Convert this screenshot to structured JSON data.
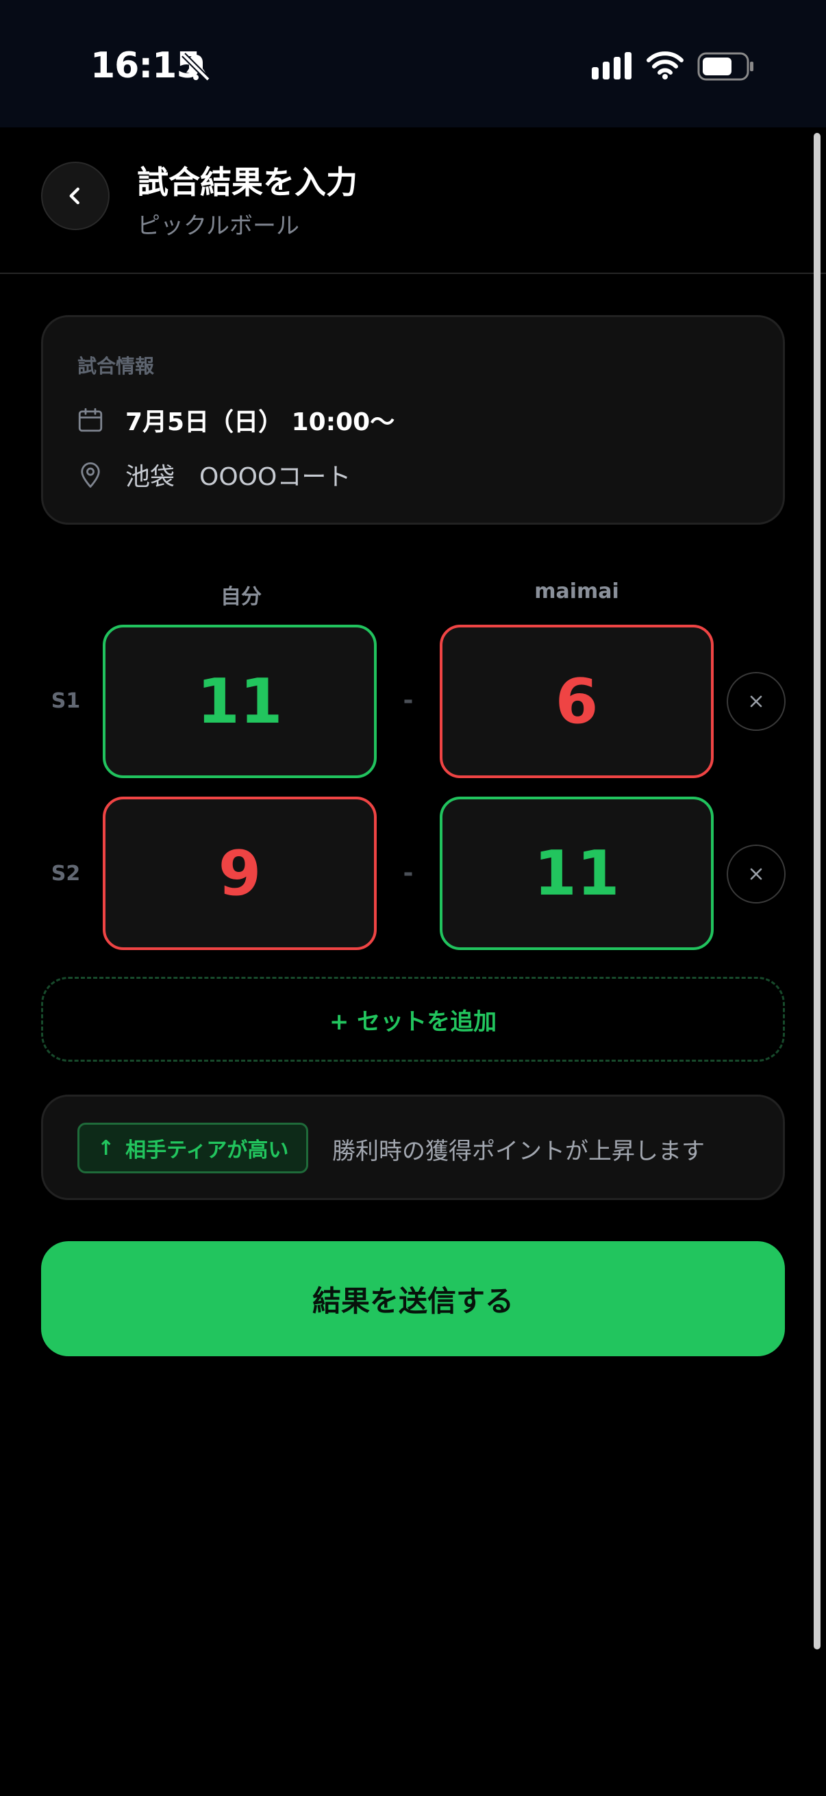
{
  "status_bar": {
    "time": "16:15"
  },
  "header": {
    "title": "試合結果を入力",
    "subtitle": "ピックルボール"
  },
  "match_info": {
    "label": "試合情報",
    "date": "7月5日（日） 10:00〜",
    "place": "池袋　OOOOコート"
  },
  "players": {
    "self": "自分",
    "opponent": "maimai"
  },
  "sets": [
    {
      "label": "S1",
      "self_score": "11",
      "opp_score": "6",
      "separator": "-"
    },
    {
      "label": "S2",
      "self_score": "9",
      "opp_score": "11",
      "separator": "-"
    }
  ],
  "add_set_label": "+ セットを追加",
  "tier": {
    "badge": "相手ティアが高い",
    "badge_icon": "↑",
    "message": "勝利時の獲得ポイントが上昇します"
  },
  "submit_label": "結果を送信する",
  "colors": {
    "win": "#22c55e",
    "lose": "#ef4444",
    "accent": "#22c55e"
  }
}
